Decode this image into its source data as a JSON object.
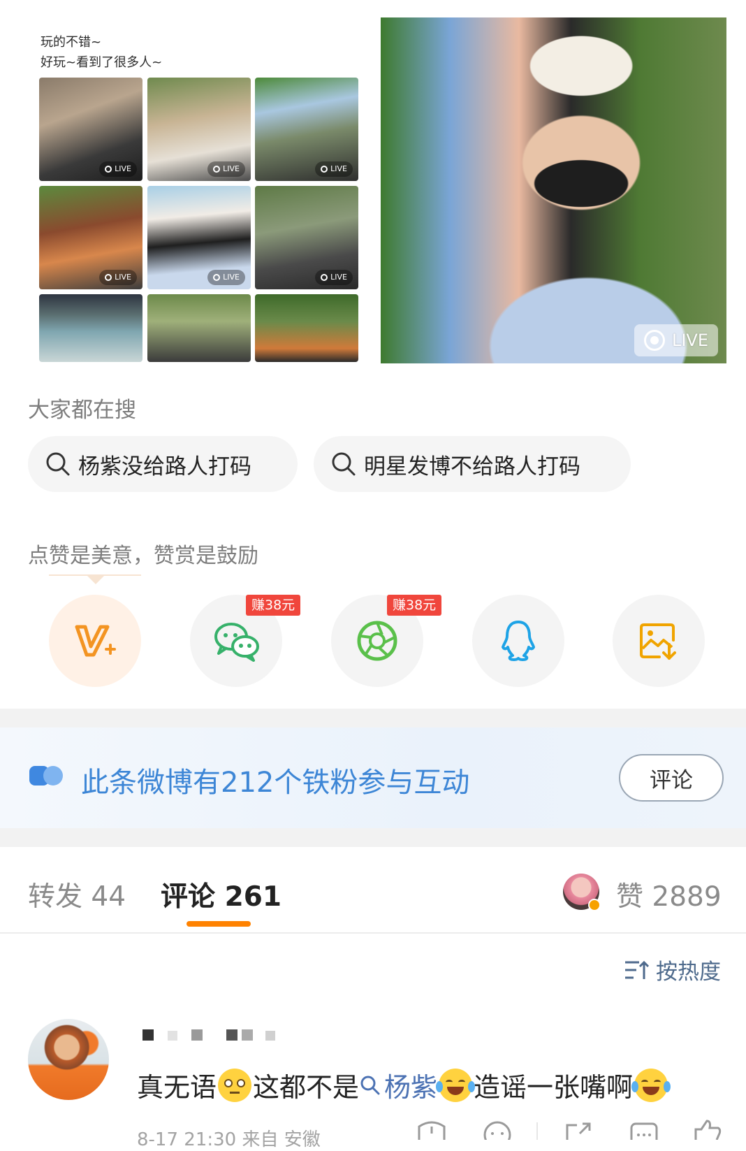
{
  "post": {
    "caption_line1": "玩的不错~",
    "caption_line2": "好玩~看到了很多人~",
    "live_label": "LIVE"
  },
  "search": {
    "title": "大家都在搜",
    "chips": [
      "杨紫没给路人打码",
      "明星发博不给路人打码"
    ]
  },
  "reward": {
    "title": "点赞是美意，赞赏是鼓励",
    "badge": "赚38元",
    "icons": [
      "vplus-icon",
      "wechat-icon",
      "moments-icon",
      "qq-icon",
      "save-image-icon"
    ]
  },
  "fans": {
    "text": "此条微博有212个铁粉参与互动",
    "button": "评论"
  },
  "tabs": {
    "repost": "转发 44",
    "comments": "评论 261",
    "likes": "赞 2889"
  },
  "sort": {
    "label": "按热度"
  },
  "comment": {
    "text_before": "真无语",
    "text_middle": "这都不是",
    "topic": "杨紫",
    "text_after": "造谣一张嘴啊",
    "meta": "8-17 21:30 来自 安徽"
  },
  "colors": {
    "accent_orange": "#ff8200",
    "link_blue": "#3d86d6",
    "badge_red": "#f0463c"
  }
}
